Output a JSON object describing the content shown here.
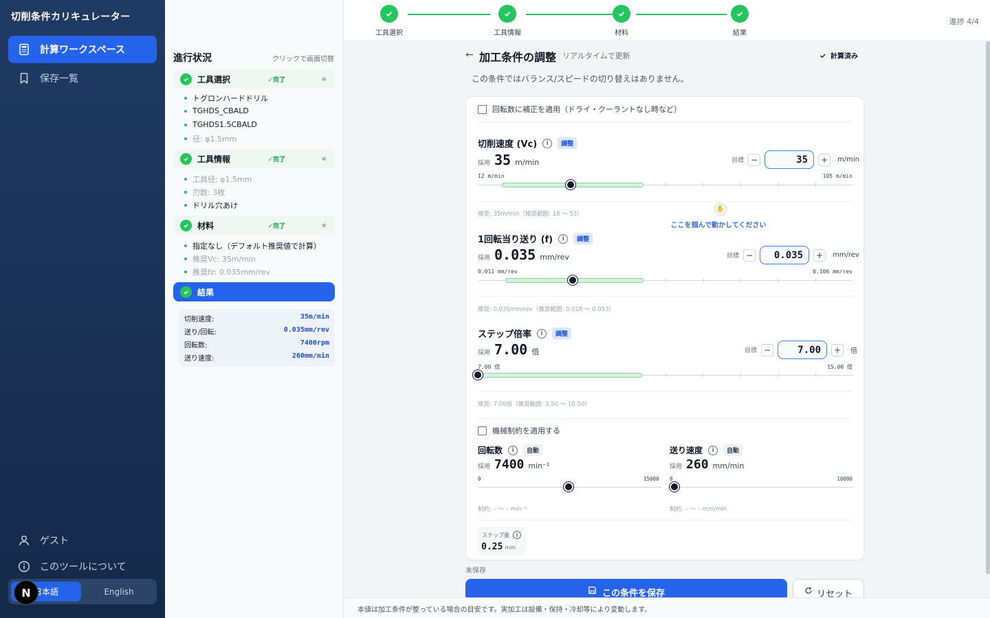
{
  "sidebar": {
    "app_title": "切削条件カリキュレーター",
    "nav": [
      {
        "label": "計算ワークスペース",
        "icon": "calculator-icon",
        "active": true
      },
      {
        "label": "保存一覧",
        "icon": "bookmark-icon",
        "active": false
      }
    ],
    "bottom": [
      {
        "label": "ゲスト",
        "icon": "user-icon"
      },
      {
        "label": "このツールについて",
        "icon": "info-icon"
      }
    ],
    "lang": {
      "ja": "日本語",
      "en": "English",
      "selected": "ja"
    },
    "logo_letter": "N"
  },
  "topbar": {
    "steps": [
      "工具選択",
      "工具情報",
      "材料",
      "結果"
    ],
    "progress_label": "進捗 4/4"
  },
  "progress_panel": {
    "title": "進行状況",
    "hint": "クリックで画面切替",
    "done_label": "✓完了",
    "sections": [
      {
        "label": "工具選択",
        "items": [
          {
            "text": "トグロンハードドリル",
            "dim": false
          },
          {
            "text": "TGHDS_CBALD",
            "dim": false
          },
          {
            "text": "TGHDS1.5CBALD",
            "dim": false
          },
          {
            "text": "径: φ1.5mm",
            "dim": true
          }
        ]
      },
      {
        "label": "工具情報",
        "items": [
          {
            "text": "工具径: φ1.5mm",
            "dim": true
          },
          {
            "text": "刃数: 3枚",
            "dim": true
          },
          {
            "text": "ドリル穴あけ",
            "dim": false
          }
        ]
      },
      {
        "label": "材料",
        "items": [
          {
            "text": "指定なし（デフォルト推奨値で計算）",
            "dim": false
          },
          {
            "text": "推奨Vc: 35m/min",
            "dim": true
          },
          {
            "text": "推奨fz: 0.035mm/rev",
            "dim": true
          }
        ]
      }
    ],
    "current": "結果",
    "summary": [
      {
        "label": "切削速度:",
        "value": "35m/min"
      },
      {
        "label": "送り/回転:",
        "value": "0.035mm/rev"
      },
      {
        "label": "回転数:",
        "value": "7400rpm"
      },
      {
        "label": "送り速度:",
        "value": "260mm/min"
      }
    ]
  },
  "main": {
    "title": "加工条件の調整",
    "subtitle": "リアルタイムで更新",
    "status": "計算済み",
    "note": "この条件ではバランス/スピードの切り替えはありません。",
    "rpm_correction_label": "回転数に補正を適用（ドライ・クーラントなし時など）",
    "adopt_label": "採用",
    "target_label": "目標",
    "adjust_badge": "調整",
    "auto_badge": "自動",
    "drag_hint": "ここを掴んで動かしてください",
    "vc": {
      "title": "切削速度 (Vc)",
      "value": "35",
      "unit": "m/min",
      "target": "35",
      "min_label": "12 m/min",
      "max_label": "105 m/min",
      "rec": "推奨: 35m/min（推奨範囲: 18 〜 53）",
      "min": 12,
      "max": 105,
      "current": 35,
      "rec_low": 18,
      "rec_high": 53
    },
    "f": {
      "title": "1回転当り送り (f)",
      "value": "0.035",
      "unit": "mm/rev",
      "target": "0.035",
      "min_label": "0.011 mm/rev",
      "max_label": "0.106 mm/rev",
      "rec": "推奨: 0.035mm/rev（推奨範囲: 0.018 〜 0.053）",
      "min": 0.011,
      "max": 0.106,
      "current": 0.035,
      "rec_low": 0.018,
      "rec_high": 0.053
    },
    "step": {
      "title": "ステップ倍率",
      "value": "7.00",
      "unit": "倍",
      "target": "7.00",
      "min_label": "7.00 倍",
      "max_label": "15.00 倍",
      "rec": "推奨: 7.00倍（推奨範囲: 3.50 〜 10.50）",
      "min": 7,
      "max": 15,
      "current": 7,
      "rec_low": 3.5,
      "rec_high": 10.5
    },
    "machine_limit_label": "機械制約を適用する",
    "rpm": {
      "title": "回転数",
      "value": "7400",
      "unit": "min⁻¹",
      "min_label": "0",
      "max_label": "15000",
      "limit": "制約: – 〜 – min⁻¹",
      "min": 0,
      "max": 15000,
      "current": 7400
    },
    "feed": {
      "title": "送り速度",
      "value": "260",
      "unit": "mm/min",
      "min_label": "0",
      "max_label": "10000",
      "limit": "制約: – 〜 – mm/min",
      "min": 0,
      "max": 10000,
      "current": 260
    },
    "step_amount": {
      "label": "ステップ量",
      "value": "0.25",
      "unit": "mm"
    },
    "unsaved": "未保存",
    "save_button": "この条件を保存",
    "reset_button": "リセット"
  },
  "footer": "本値は加工条件が整っている場合の目安です。実加工は設備・保持・冷却等により変動します。",
  "colors": {
    "accent": "#2563eb",
    "success": "#22c55e",
    "sidebar": "#1f3b63"
  }
}
